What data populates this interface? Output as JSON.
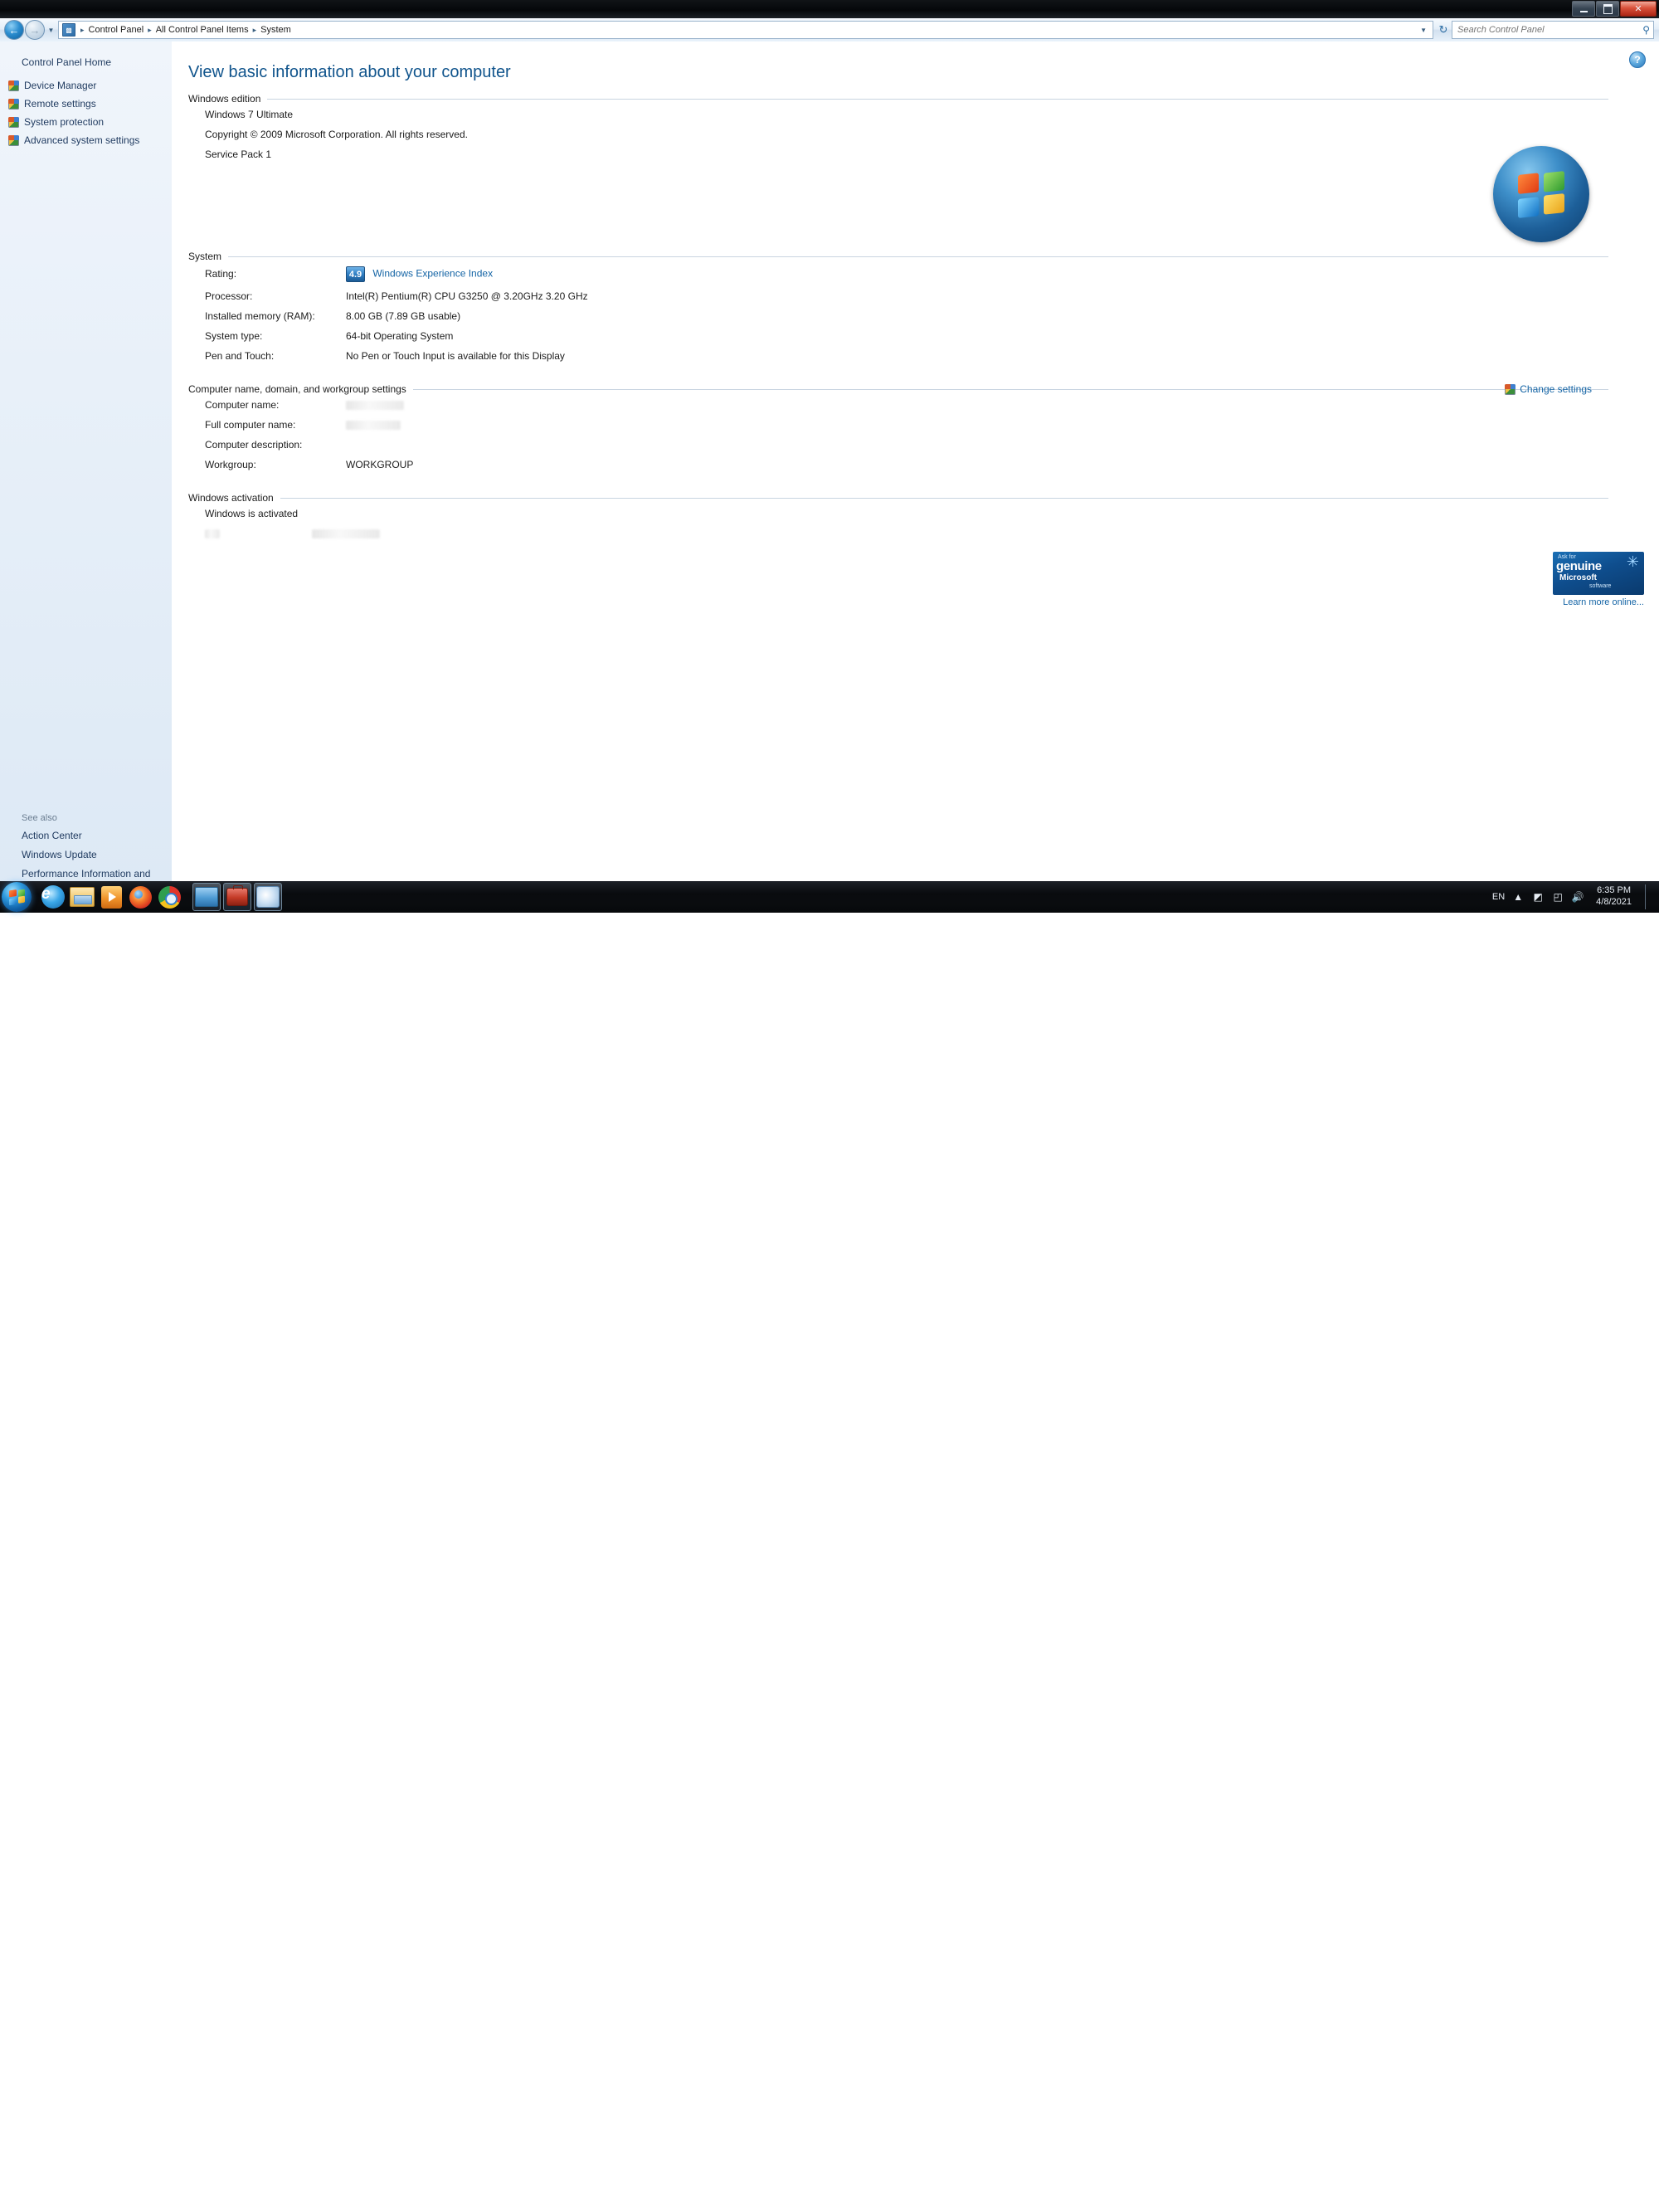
{
  "window": {
    "controls": {
      "minimize": "minimize-button",
      "maximize": "maximize-button",
      "close": "close-button"
    }
  },
  "addressbar": {
    "back_glyph": "←",
    "forward_glyph": "→",
    "dropdown_glyph": "▼",
    "breadcrumb": [
      "Control Panel",
      "All Control Panel Items",
      "System"
    ],
    "separator": "▸",
    "chevron_glyph": "▼",
    "refresh_glyph": "↻",
    "search_placeholder": "Search Control Panel",
    "search_value": "",
    "search_icon_glyph": "⚲"
  },
  "sidebar": {
    "home_label": "Control Panel Home",
    "items": [
      {
        "label": "Device Manager"
      },
      {
        "label": "Remote settings"
      },
      {
        "label": "System protection"
      },
      {
        "label": "Advanced system settings"
      }
    ],
    "see_also_heading": "See also",
    "see_also": [
      {
        "label": "Action Center"
      },
      {
        "label": "Windows Update"
      },
      {
        "label": "Performance Information and Tools"
      }
    ]
  },
  "content": {
    "help_glyph": "?",
    "page_title": "View basic information about your computer",
    "windows_edition": {
      "heading": "Windows edition",
      "edition": "Windows 7 Ultimate",
      "copyright": "Copyright © 2009 Microsoft Corporation.  All rights reserved.",
      "service_pack": "Service Pack 1"
    },
    "system": {
      "heading": "System",
      "rows": [
        {
          "label": "Rating:",
          "value": "",
          "badge": "4.9",
          "link": "Windows Experience Index"
        },
        {
          "label": "Processor:",
          "value": "Intel(R) Pentium(R) CPU G3250 @ 3.20GHz   3.20 GHz"
        },
        {
          "label": "Installed memory (RAM):",
          "value": "8.00 GB (7.89 GB usable)"
        },
        {
          "label": "System type:",
          "value": "64-bit Operating System"
        },
        {
          "label": "Pen and Touch:",
          "value": "No Pen or Touch Input is available for this Display"
        }
      ]
    },
    "computer_name": {
      "heading": "Computer name, domain, and workgroup settings",
      "change_settings_label": "Change settings",
      "rows": [
        {
          "label": "Computer name:",
          "value": "",
          "redacted": true
        },
        {
          "label": "Full computer name:",
          "value": "",
          "redacted": true
        },
        {
          "label": "Computer description:",
          "value": ""
        },
        {
          "label": "Workgroup:",
          "value": "WORKGROUP"
        }
      ]
    },
    "activation": {
      "heading": "Windows activation",
      "status": "Windows is activated",
      "product_id_label": "",
      "product_id_value": "",
      "genuine_badge": {
        "line1": "Ask for",
        "line2": "genuine",
        "line3": "Microsoft",
        "line4": "software",
        "star_glyph": "✳"
      },
      "learn_more_label": "Learn more online..."
    }
  },
  "taskbar": {
    "start_label": "start-orb",
    "pinned": [
      {
        "name": "internet-explorer-icon"
      },
      {
        "name": "windows-explorer-icon"
      },
      {
        "name": "windows-media-player-icon"
      },
      {
        "name": "firefox-icon"
      },
      {
        "name": "chrome-icon"
      }
    ],
    "running": [
      {
        "name": "running-window-control-panel"
      },
      {
        "name": "running-window-toolbox"
      },
      {
        "name": "running-window-paint"
      }
    ],
    "tray": {
      "language": "EN",
      "show_hidden_glyph": "▲",
      "network_glyph": "◩",
      "action_center_glyph": "◰",
      "volume_glyph": "🔊",
      "time": "6:35 PM",
      "date": "4/8/2021"
    }
  },
  "colors": {
    "accent_link": "#1464a5",
    "title_blue": "#10548c",
    "sidebar_bg": "#e8f0f9",
    "taskbar_bg": "#0a0c0f",
    "close_red": "#d9513a"
  }
}
